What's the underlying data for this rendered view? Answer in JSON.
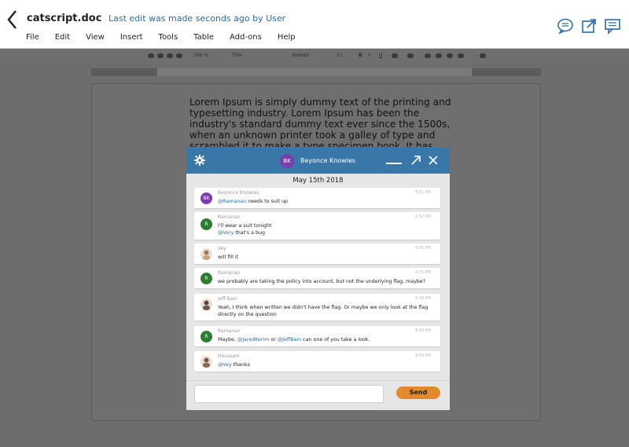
{
  "header": {
    "doc_title": "catscript.doc",
    "edit_status": "Last edit was made seconds ago by User",
    "menu": [
      "File",
      "Edit",
      "View",
      "Insert",
      "Tools",
      "Table",
      "Add-ons",
      "Help"
    ],
    "icons": [
      "chat-bubbles-icon",
      "share-icon",
      "comment-icon"
    ]
  },
  "toolbar": {
    "zoom": "100 %",
    "style": "Title",
    "font": "Roboto",
    "size": "11",
    "bold": "B",
    "italic": "I",
    "underline": "U"
  },
  "document": {
    "body": "Lorem Ipsum is simply dummy text of the printing and typesetting industry. Lorem Ipsum has been the industry's standard dummy text ever since the 1500s, when an unknown printer took a galley of type and scrambled it to make a type specimen book. It has survived not only five centuries, but also"
  },
  "chat": {
    "header_name": "Beyonce Knowles",
    "header_initials": "BK",
    "date": "May 15th 2018",
    "messages": [
      {
        "name": "Beyonce Knowles",
        "initials": "BK",
        "time": "4:51 PM",
        "color": "#7a3db0",
        "mention": "@Ramanan",
        "text": " needs to suit up",
        "line2": ""
      },
      {
        "name": "Ramanan",
        "initials": "R",
        "time": "4:52 PM",
        "color": "#2e7d32",
        "mention": "",
        "text": "I'll wear a suit tonight",
        "line2_mention": "@Very",
        "line2": " that's a bug"
      },
      {
        "name": "Vey",
        "initials": "",
        "time": "4:55 PM",
        "color": "#c9a27a",
        "mention": "",
        "text": "will fill it",
        "line2": ""
      },
      {
        "name": "Ramanan",
        "initials": "R",
        "time": "4:55 PM",
        "color": "#2e7d32",
        "mention": "",
        "text": "we probably are taking the policy into account, but not the underlying flag, maybe?",
        "line2": ""
      },
      {
        "name": "Jeff Bain",
        "initials": "",
        "time": "4:58 PM",
        "color": "#6b5a4a",
        "mention": "",
        "text": "Yeah, I think when written we didn't have the flag. Or maybe we only look at the flag",
        "line2": "directly on the question"
      },
      {
        "name": "Ramanan",
        "initials": "R",
        "time": "4:58 PM",
        "color": "#2e7d32",
        "pre": "Maybe, ",
        "mention": "@JaredKerim",
        "mid": " or ",
        "mention2": "@JeffBain",
        "text": " can one of you take a look.",
        "line2": ""
      },
      {
        "name": "Houssam",
        "initials": "",
        "time": "4:59 PM",
        "color": "#8a6a55",
        "mention": "@Vey",
        "text": " thanks",
        "line2": ""
      }
    ],
    "input_placeholder": "",
    "send_label": "Send"
  },
  "colors": {
    "header_blue": "#3a77a9",
    "send_orange": "#e28a2e",
    "link_blue": "#2d6ba3"
  }
}
